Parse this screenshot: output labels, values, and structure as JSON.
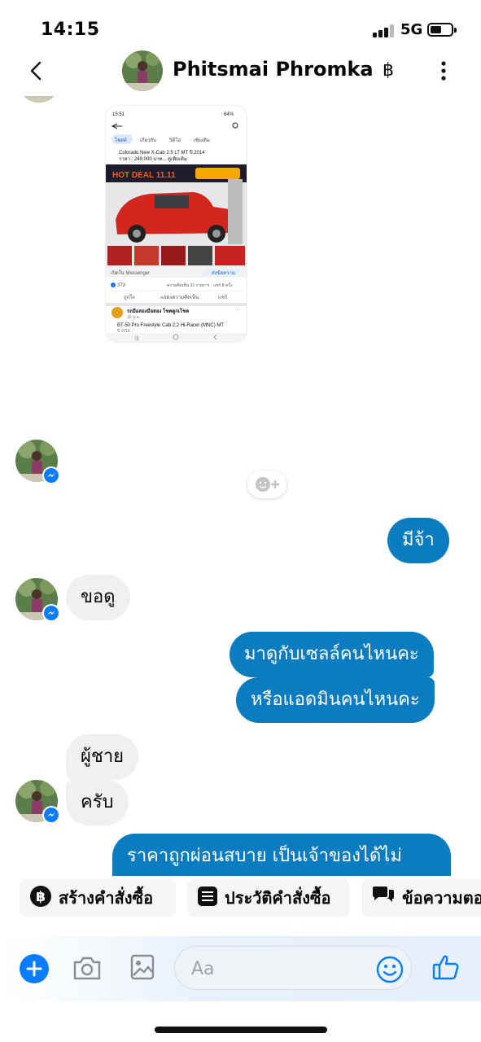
{
  "status_bar": {
    "time": "14:15",
    "network": "5G"
  },
  "header": {
    "contact_name": "Phitsmai Phromka",
    "currency_symbol": "฿"
  },
  "shared_image": {
    "status_time": "15:51",
    "tabs": [
      "โพสต์",
      "เกี่ยวกับ",
      "วิดีโอ",
      "เพิ่มเติม"
    ],
    "post_title": "Colorado New X-Cab 2.5 LT MT ปี 2014",
    "post_price": "ราคา : 249,000 บาท... ดูเพิ่มเติม",
    "banner_text": "HOT DEAL 11.11",
    "messenger_link": "เปิดใน Messenger",
    "send_message": "ส่งข้อความ",
    "likes_count": "373",
    "comments_shares": "ความคิดเห็น 31 รายการ · แชร์ 8 ครั้ง",
    "action_like": "ถูกใจ",
    "action_comment": "แสดงความคิดเห็น",
    "action_share": "แชร์",
    "page_name": "รถมือสองมือสอง โชคดูกเโชค",
    "page_time": "16 ม.ค.",
    "next_post_title": "BT-50 Pro Freestyle Cab 2.2 Hi-Racer (MNC) MT",
    "next_post_year": "ปี 2018"
  },
  "messages": [
    {
      "id": "m1",
      "direction": "out",
      "text": "มีจ้า"
    },
    {
      "id": "m2",
      "direction": "in",
      "text": "ขอดู"
    },
    {
      "id": "m3",
      "direction": "out",
      "text": "มาดูกับเซลล์คนไหนคะ"
    },
    {
      "id": "m4",
      "direction": "out",
      "text": "หรือแอดมินคนไหนคะ"
    },
    {
      "id": "m5",
      "direction": "in",
      "text": "ผู้ชาย"
    },
    {
      "id": "m6",
      "direction": "in",
      "text": "ครับ"
    },
    {
      "id": "m7",
      "direction": "out",
      "text": "ราคาถูกผ่อนสบาย เป็นเจ้าของได้ไม่"
    }
  ],
  "quick_replies": [
    {
      "label": "สร้างคำสั่งซื้อ",
      "icon": "baht-circle-icon"
    },
    {
      "label": "ประวัติคำสั่งซื้อ",
      "icon": "list-icon"
    },
    {
      "label": "ข้อความตอ",
      "icon": "chat-bubbles-icon"
    }
  ],
  "composer": {
    "placeholder": "Aa"
  },
  "colors": {
    "accent": "#0a7cbf",
    "incoming": "#f0f0f0",
    "messenger_blue": "#0a7cff"
  }
}
